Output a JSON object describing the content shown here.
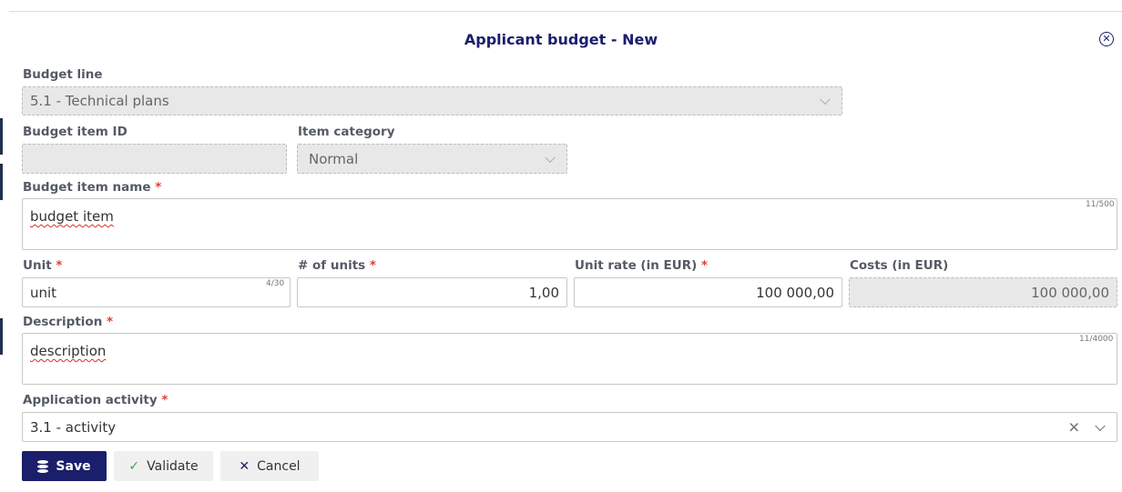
{
  "dialog": {
    "title": "Applicant budget - New"
  },
  "fields": {
    "budget_line": {
      "label": "Budget line",
      "value": "5.1 - Technical plans"
    },
    "budget_item_id": {
      "label": "Budget item ID",
      "value": ""
    },
    "item_category": {
      "label": "Item category",
      "value": "Normal"
    },
    "budget_item_name": {
      "label": "Budget item name",
      "required_mark": "*",
      "value": "budget item",
      "counter": "11/500"
    },
    "unit": {
      "label": "Unit",
      "required_mark": "*",
      "value": "unit",
      "counter": "4/30"
    },
    "num_units": {
      "label": "# of units",
      "required_mark": "*",
      "value": "1,00"
    },
    "unit_rate": {
      "label": "Unit rate (in EUR)",
      "required_mark": "*",
      "value": "100 000,00"
    },
    "costs": {
      "label": "Costs (in EUR)",
      "value": "100 000,00"
    },
    "description": {
      "label": "Description",
      "required_mark": "*",
      "value": "description",
      "counter": "11/4000"
    },
    "application_activity": {
      "label": "Application activity",
      "required_mark": "*",
      "value": "3.1 - activity"
    }
  },
  "buttons": {
    "save": "Save",
    "validate": "Validate",
    "cancel": "Cancel"
  },
  "icons": {
    "close": "close-circle-icon",
    "save": "database-icon",
    "validate": "check-icon",
    "cancel": "x-icon",
    "dropdown": "chevron-down-icon",
    "clear": "x-icon"
  },
  "colors": {
    "primary": "#1b1e6b",
    "required": "#e0403a",
    "disabled_bg": "#e8e8e8",
    "validate_check": "#3aa83a"
  }
}
